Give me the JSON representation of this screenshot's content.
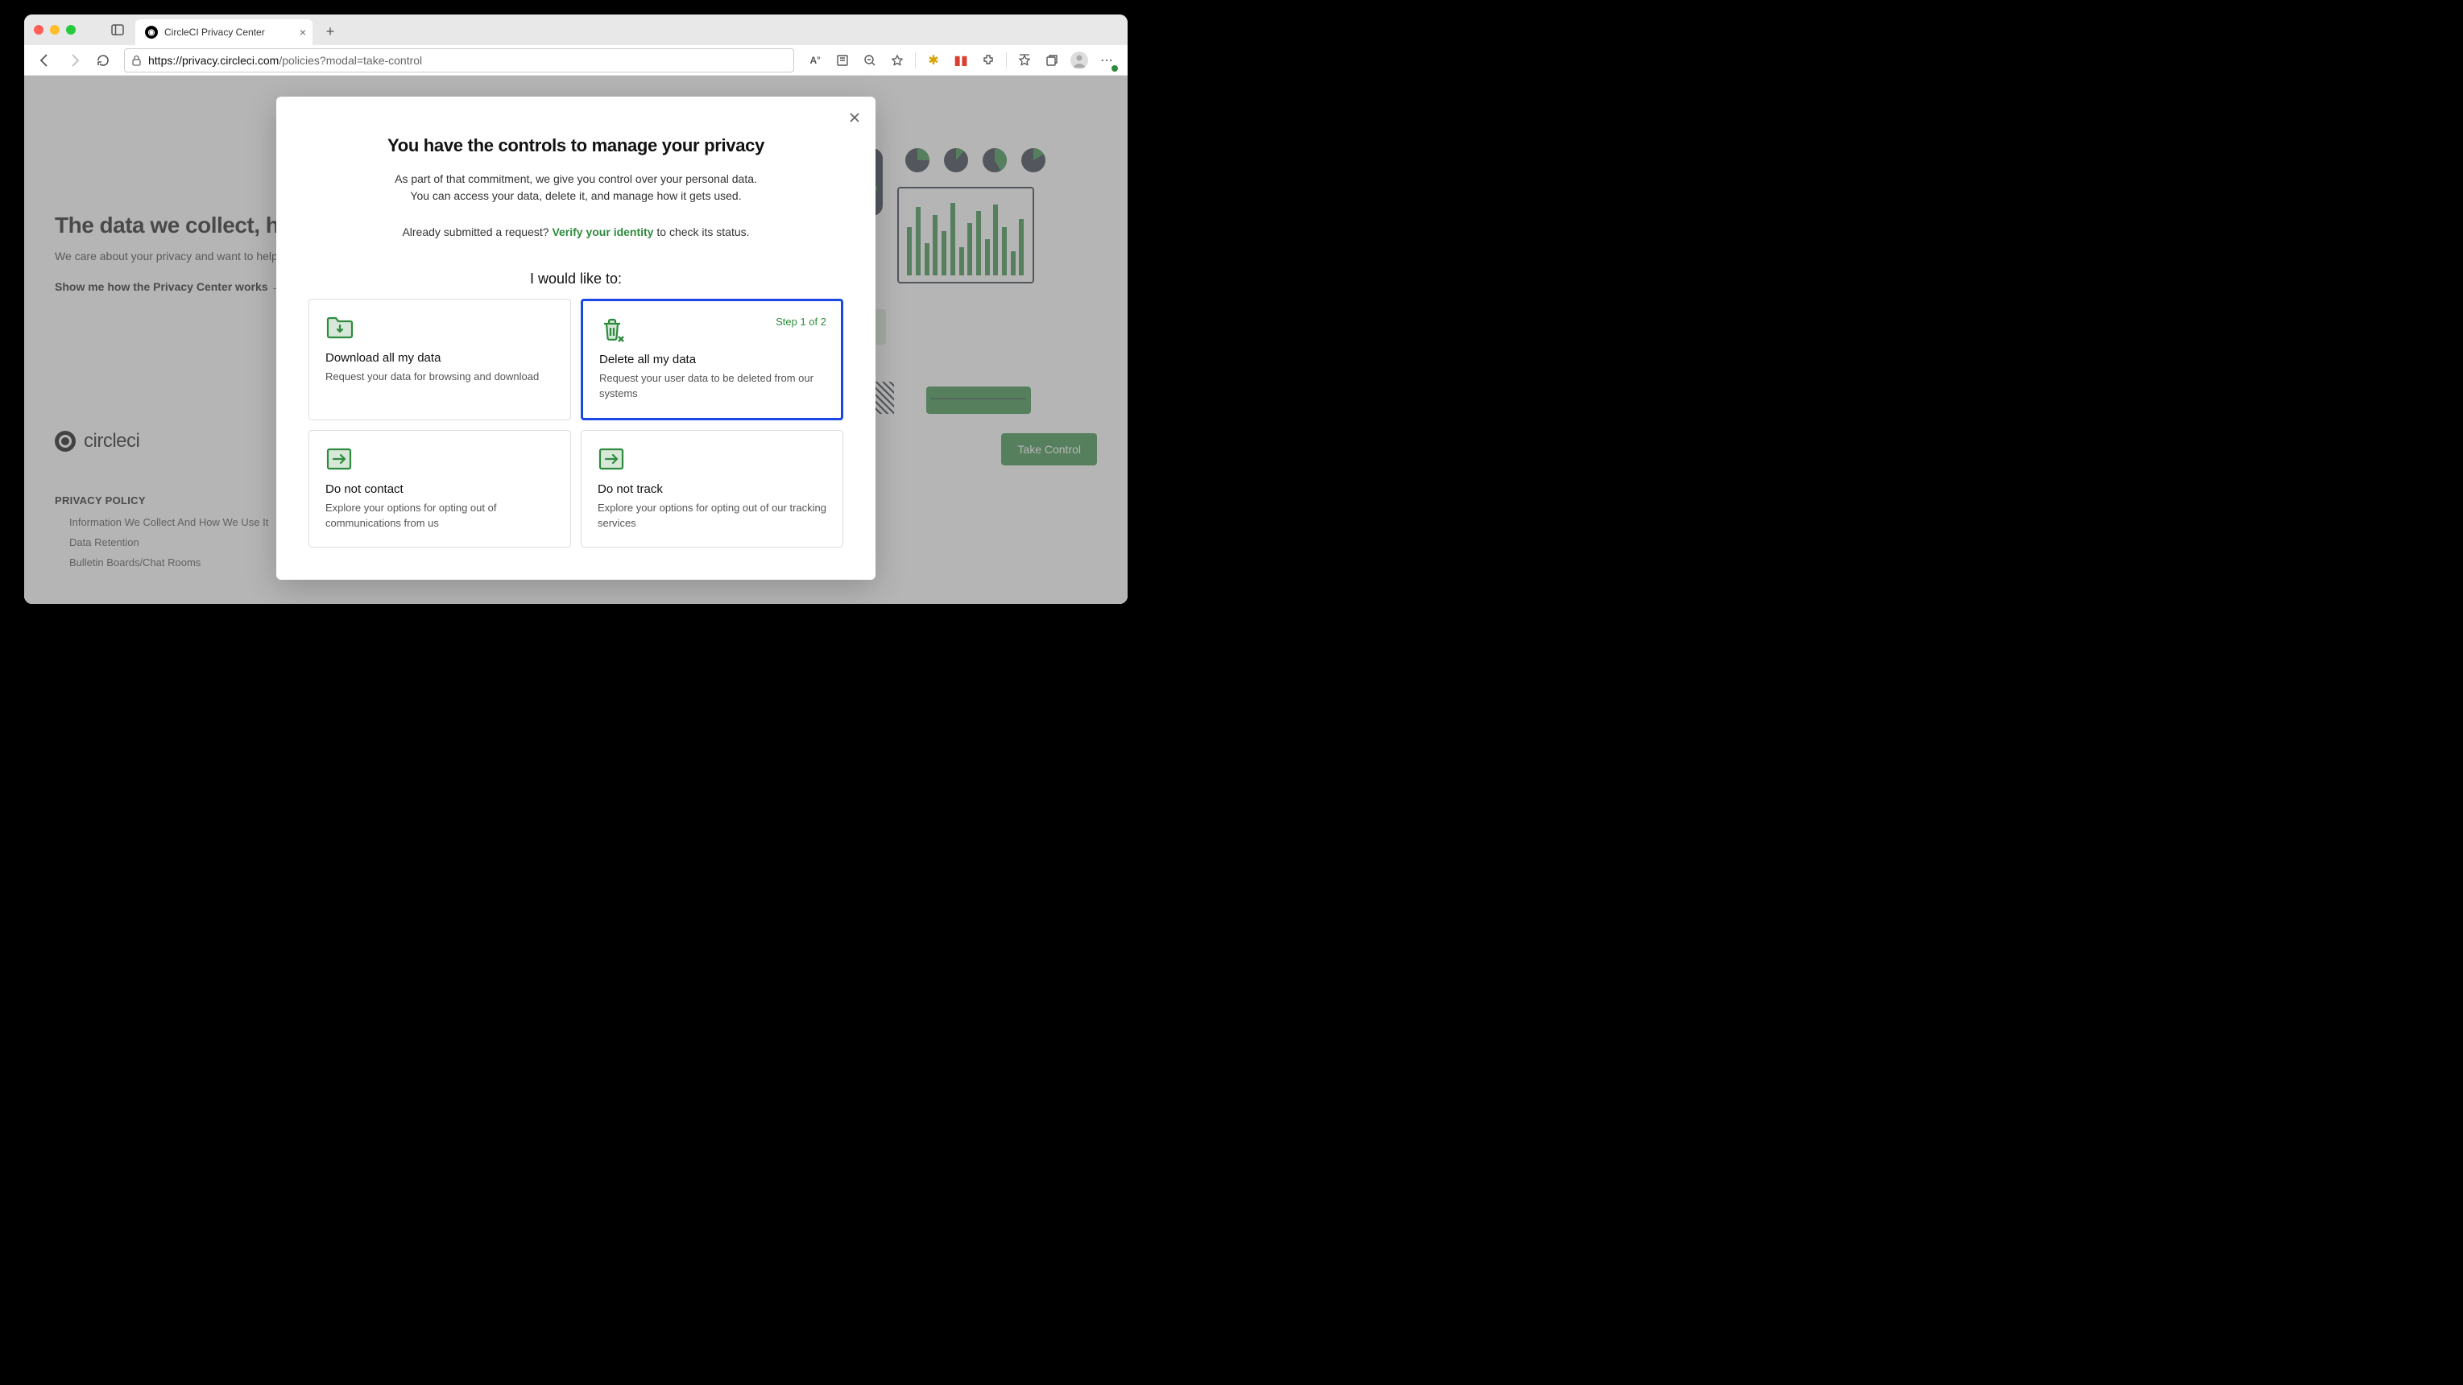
{
  "browser": {
    "tab_title": "CircleCI Privacy Center",
    "url_domain": "https://privacy.circleci.com",
    "url_path": "/policies?modal=take-control"
  },
  "page": {
    "heading": "The data we collect, how it's u",
    "subtext": "We care about your privacy and want to help you under",
    "show_me_link": "Show me how the Privacy Center works",
    "logo_text": "circleci",
    "policy_header": "PRIVACY POLICY",
    "policy_items": [
      "Information We Collect And How We Use It",
      "Data Retention",
      "Bulletin Boards/Chat Rooms"
    ],
    "take_control_btn": "Take Control"
  },
  "modal": {
    "title": "You have the controls to manage your privacy",
    "description": "As part of that commitment, we give you control over your personal data. You can access your data, delete it, and manage how it gets used.",
    "status_prefix": "Already submitted a request? ",
    "status_link": "Verify your identity",
    "status_suffix": " to check its status.",
    "subheading": "I would like to:",
    "cards": [
      {
        "title": "Download all my data",
        "desc": "Request your data for browsing and download",
        "step": ""
      },
      {
        "title": "Delete all my data",
        "desc": "Request your user data to be deleted from our systems",
        "step": "Step 1 of 2"
      },
      {
        "title": "Do not contact",
        "desc": "Explore your options for opting out of communications from us",
        "step": ""
      },
      {
        "title": "Do not track",
        "desc": "Explore your options for opting out of our tracking services",
        "step": ""
      }
    ]
  }
}
